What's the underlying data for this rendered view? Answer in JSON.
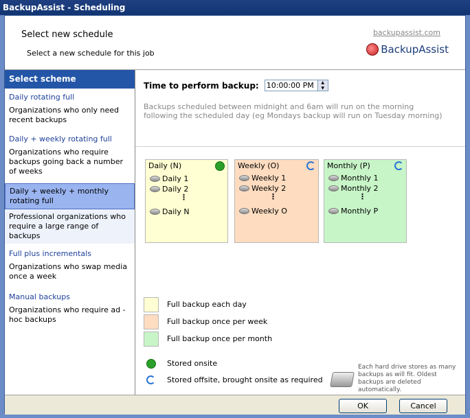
{
  "window": {
    "title": "BackupAssist - Scheduling"
  },
  "header": {
    "title": "Select new schedule",
    "subtitle": "Select a new schedule for this job",
    "link": "backupassist.com",
    "brand": "BackupAssist"
  },
  "sidebar": {
    "title": "Select scheme",
    "schemes": [
      {
        "name": "Daily rotating full",
        "desc": "Organizations who only need recent backups"
      },
      {
        "name": "Daily + weekly rotating full",
        "desc": "Organizations who require backups going back a number of weeks"
      },
      {
        "name": "Daily + weekly + monthly rotating full",
        "desc": "Professional organizations who require a large range of backups"
      },
      {
        "name": "Full plus incrementals",
        "desc": "Organizations who swap media once a week"
      },
      {
        "name": "Manual backups",
        "desc": "Organizations who require ad -hoc backups"
      }
    ]
  },
  "main": {
    "time_label": "Time to perform backup:",
    "time_value": "10:00:00 PM",
    "note": "Backups scheduled between midnight and 6am will run on the morning following the scheduled day (eg Mondays backup will run on Tuesday morning)",
    "boxes": [
      {
        "title": "Daily (N)",
        "items": [
          "Daily 1",
          "Daily 2",
          "Daily N"
        ],
        "color": "#ffffd3"
      },
      {
        "title": "Weekly (O)",
        "items": [
          "Weekly 1",
          "Weekly 2",
          "Weekly O"
        ],
        "color": "#fddcc0"
      },
      {
        "title": "Monthly (P)",
        "items": [
          "Monthly 1",
          "Monthly 2",
          "Monthly P"
        ],
        "color": "#c8f5c8"
      }
    ],
    "legend": {
      "daily": "Full backup each day",
      "weekly": "Full backup once per week",
      "monthly": "Full backup once per month",
      "onsite": "Stored onsite",
      "offsite": "Stored offsite, brought onsite as required"
    },
    "hd_note": "Each hard drive stores as many backups as will fit. Oldest backups are deleted automatically."
  },
  "footer": {
    "ok": "OK",
    "cancel": "Cancel"
  }
}
